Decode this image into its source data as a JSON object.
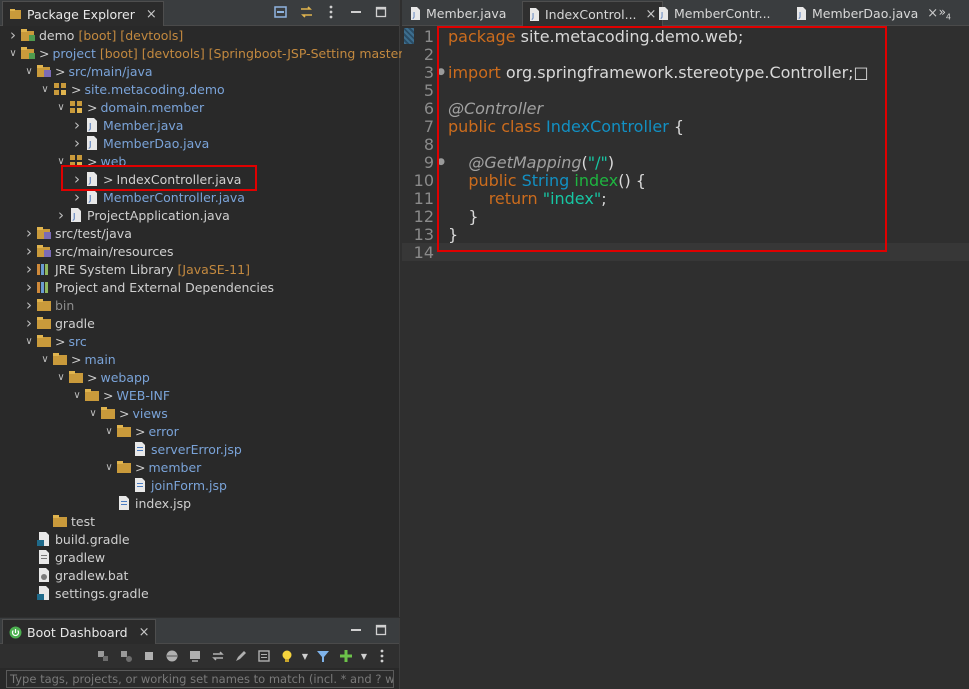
{
  "explorer": {
    "tab_label": "Package Explorer",
    "close": "×",
    "tree": [
      {
        "indent": 0,
        "arrow": ">",
        "icon": "project-icon",
        "prefix": "",
        "label": "demo",
        "dec": "[boot] [devtools]",
        "style": "plain"
      },
      {
        "indent": 0,
        "arrow": "v",
        "icon": "project-icon",
        "prefix": ">",
        "label": "project",
        "dec": "[boot] [devtools] [Springboot-JSP-Setting master]",
        "style": "link"
      },
      {
        "indent": 1,
        "arrow": "v",
        "icon": "source-folder-icon",
        "prefix": ">",
        "label": "src/main/java",
        "dec": "",
        "style": "link"
      },
      {
        "indent": 2,
        "arrow": "v",
        "icon": "package-icon",
        "prefix": ">",
        "label": "site.metacoding.demo",
        "dec": "",
        "style": "link"
      },
      {
        "indent": 3,
        "arrow": "v",
        "icon": "package-icon",
        "prefix": ">",
        "label": "domain.member",
        "dec": "",
        "style": "link"
      },
      {
        "indent": 4,
        "arrow": ">",
        "icon": "java-file-icon",
        "prefix": "",
        "label": "Member.java",
        "dec": "",
        "style": "link"
      },
      {
        "indent": 4,
        "arrow": ">",
        "icon": "java-file-icon",
        "prefix": "",
        "label": "MemberDao.java",
        "dec": "",
        "style": "link"
      },
      {
        "indent": 3,
        "arrow": "v",
        "icon": "package-icon",
        "prefix": ">",
        "label": "web",
        "dec": "",
        "style": "link"
      },
      {
        "indent": 4,
        "arrow": ">",
        "icon": "java-file-icon",
        "prefix": ">",
        "label": "IndexController.java",
        "dec": "",
        "style": "plain"
      },
      {
        "indent": 4,
        "arrow": ">",
        "icon": "java-file-icon",
        "prefix": "",
        "label": "MemberController.java",
        "dec": "",
        "style": "link"
      },
      {
        "indent": 3,
        "arrow": ">",
        "icon": "java-file-icon",
        "prefix": "",
        "label": "ProjectApplication.java",
        "dec": "",
        "style": "plain"
      },
      {
        "indent": 1,
        "arrow": ">",
        "icon": "source-folder-icon",
        "prefix": "",
        "label": "src/test/java",
        "dec": "",
        "style": "plain"
      },
      {
        "indent": 1,
        "arrow": ">",
        "icon": "source-folder-icon",
        "prefix": "",
        "label": "src/main/resources",
        "dec": "",
        "style": "plain"
      },
      {
        "indent": 1,
        "arrow": ">",
        "icon": "library-icon",
        "prefix": "",
        "label": "JRE System Library",
        "dec": "[JavaSE-11]",
        "style": "plain"
      },
      {
        "indent": 1,
        "arrow": ">",
        "icon": "library-icon",
        "prefix": "",
        "label": "Project and External Dependencies",
        "dec": "",
        "style": "plain"
      },
      {
        "indent": 1,
        "arrow": ">",
        "icon": "folder-icon",
        "prefix": "",
        "label": "bin",
        "dec": "",
        "style": "gray"
      },
      {
        "indent": 1,
        "arrow": ">",
        "icon": "folder-icon",
        "prefix": "",
        "label": "gradle",
        "dec": "",
        "style": "plain"
      },
      {
        "indent": 1,
        "arrow": "v",
        "icon": "folder-icon",
        "prefix": ">",
        "label": "src",
        "dec": "",
        "style": "link"
      },
      {
        "indent": 2,
        "arrow": "v",
        "icon": "folder-icon",
        "prefix": ">",
        "label": "main",
        "dec": "",
        "style": "link"
      },
      {
        "indent": 3,
        "arrow": "v",
        "icon": "folder-icon",
        "prefix": ">",
        "label": "webapp",
        "dec": "",
        "style": "link"
      },
      {
        "indent": 4,
        "arrow": "v",
        "icon": "folder-icon",
        "prefix": ">",
        "label": "WEB-INF",
        "dec": "",
        "style": "link"
      },
      {
        "indent": 5,
        "arrow": "v",
        "icon": "folder-icon",
        "prefix": ">",
        "label": "views",
        "dec": "",
        "style": "link"
      },
      {
        "indent": 6,
        "arrow": "v",
        "icon": "folder-icon",
        "prefix": ">",
        "label": "error",
        "dec": "",
        "style": "link"
      },
      {
        "indent": 7,
        "arrow": "",
        "icon": "jsp-file-icon",
        "prefix": "",
        "label": "serverError.jsp",
        "dec": "",
        "style": "link"
      },
      {
        "indent": 6,
        "arrow": "v",
        "icon": "folder-icon",
        "prefix": ">",
        "label": "member",
        "dec": "",
        "style": "link"
      },
      {
        "indent": 7,
        "arrow": "",
        "icon": "jsp-file-icon",
        "prefix": "",
        "label": "joinForm.jsp",
        "dec": "",
        "style": "link"
      },
      {
        "indent": 6,
        "arrow": "",
        "icon": "jsp-file-icon",
        "prefix": "",
        "label": "index.jsp",
        "dec": "",
        "style": "plain"
      },
      {
        "indent": 2,
        "arrow": "",
        "icon": "folder-icon",
        "prefix": "",
        "label": "test",
        "dec": "",
        "style": "plain"
      },
      {
        "indent": 1,
        "arrow": "",
        "icon": "gradle-file-icon",
        "prefix": "",
        "label": "build.gradle",
        "dec": "",
        "style": "plain"
      },
      {
        "indent": 1,
        "arrow": "",
        "icon": "file-icon",
        "prefix": "",
        "label": "gradlew",
        "dec": "",
        "style": "plain"
      },
      {
        "indent": 1,
        "arrow": "",
        "icon": "bat-file-icon",
        "prefix": "",
        "label": "gradlew.bat",
        "dec": "",
        "style": "plain"
      },
      {
        "indent": 1,
        "arrow": "",
        "icon": "gradle-file-icon",
        "prefix": "",
        "label": "settings.gradle",
        "dec": "",
        "style": "plain"
      }
    ]
  },
  "boot": {
    "tab_label": "Boot Dashboard",
    "close": "×",
    "filter_placeholder": "Type tags, projects, or working set names to match (incl. * and ? wildc"
  },
  "editor": {
    "tabs": [
      {
        "label": "Member.java",
        "active": false,
        "closable": false
      },
      {
        "label": "IndexControl...",
        "active": true,
        "closable": true
      },
      {
        "label": "MemberContr...",
        "active": false,
        "closable": false
      },
      {
        "label": "MemberDao.java",
        "active": false,
        "closable": true
      }
    ],
    "overflow": "»",
    "overflow_count": "4",
    "lines": [
      {
        "n": "1",
        "fold": "",
        "tokens": [
          [
            "k",
            "package"
          ],
          [
            "p",
            " site.metacoding.demo.web;"
          ]
        ]
      },
      {
        "n": "2",
        "fold": "",
        "tokens": []
      },
      {
        "n": "3",
        "fold": "+",
        "tokens": [
          [
            "k",
            "import"
          ],
          [
            "p",
            " org.springframework.stereotype.Controller;"
          ],
          [
            "p",
            "□"
          ]
        ]
      },
      {
        "n": "5",
        "fold": "",
        "tokens": []
      },
      {
        "n": "6",
        "fold": "",
        "tokens": [
          [
            "a",
            "@Controller"
          ]
        ]
      },
      {
        "n": "7",
        "fold": "",
        "tokens": [
          [
            "k",
            "public class "
          ],
          [
            "t",
            "IndexController"
          ],
          [
            "p",
            " {"
          ]
        ]
      },
      {
        "n": "8",
        "fold": "",
        "tokens": []
      },
      {
        "n": "9",
        "fold": "-",
        "tokens": [
          [
            "p",
            "    "
          ],
          [
            "a",
            "@GetMapping"
          ],
          [
            "p",
            "("
          ],
          [
            "s",
            "\"/\""
          ],
          [
            "p",
            ")"
          ]
        ]
      },
      {
        "n": "10",
        "fold": "",
        "tokens": [
          [
            "p",
            "    "
          ],
          [
            "k",
            "public "
          ],
          [
            "t",
            "String "
          ],
          [
            "m",
            "index"
          ],
          [
            "p",
            "() {"
          ]
        ]
      },
      {
        "n": "11",
        "fold": "",
        "tokens": [
          [
            "p",
            "        "
          ],
          [
            "k",
            "return "
          ],
          [
            "s",
            "\"index\""
          ],
          [
            "p",
            ";"
          ]
        ]
      },
      {
        "n": "12",
        "fold": "",
        "tokens": [
          [
            "p",
            "    }"
          ]
        ]
      },
      {
        "n": "13",
        "fold": "",
        "tokens": [
          [
            "p",
            "}"
          ]
        ]
      },
      {
        "n": "14",
        "fold": "",
        "tokens": []
      }
    ]
  },
  "colors": {
    "keyword": "#cc6c1d",
    "type": "#1290c3",
    "method": "#1eb540",
    "string": "#17c6a3",
    "annotation": "#a0a0a0",
    "link": "#7aa3d8",
    "decoration": "#c3893f",
    "highlight_box": "#e00000"
  }
}
